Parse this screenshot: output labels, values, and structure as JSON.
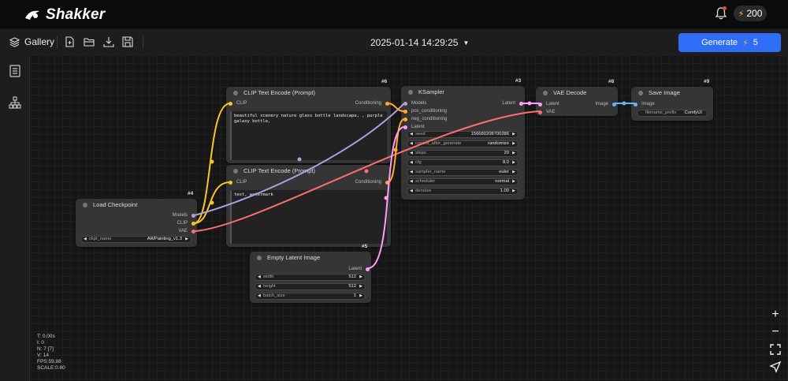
{
  "header": {
    "brand": "Shakker",
    "credits": "200"
  },
  "toolbar": {
    "gallery_label": "Gallery",
    "workflow_title": "2025-01-14 14:29:25",
    "generate_label": "Generate",
    "generate_cost": "5"
  },
  "nodes": {
    "clip_pos": {
      "id": "#6",
      "title": "CLIP Text Encode (Prompt)",
      "input_clip": "CLIP",
      "output": "Conditioning",
      "text": "beautiful scenery nature glass bottle landscape, , purple galaxy bottle,"
    },
    "clip_neg": {
      "id": "",
      "title": "CLIP Text Encode (Prompt)",
      "input_clip": "CLIP",
      "output": "Conditioning",
      "text": "text, watermark"
    },
    "ksampler": {
      "id": "#3",
      "title": "KSampler",
      "inputs": [
        "Models",
        "pos_conditioning",
        "neg_conditioning",
        "Latent"
      ],
      "output": "Latent",
      "widgets": [
        {
          "label": "seed",
          "value": "156680208700286"
        },
        {
          "label": "control_after_generate",
          "value": "randomize"
        },
        {
          "label": "steps",
          "value": "20"
        },
        {
          "label": "cfg",
          "value": "8.0"
        },
        {
          "label": "sampler_name",
          "value": "euler"
        },
        {
          "label": "scheduler",
          "value": "normal"
        },
        {
          "label": "denoise",
          "value": "1.00"
        }
      ]
    },
    "vae_decode": {
      "id": "#8",
      "title": "VAE Decode",
      "inputs": [
        "Latent",
        "VAE"
      ],
      "output": "Image"
    },
    "save_image": {
      "id": "#9",
      "title": "Save Image",
      "input": "Image",
      "widget_label": "filename_prefix",
      "widget_value": "ComfyUI"
    },
    "load_checkpoint": {
      "id": "#4",
      "title": "Load Checkpoint",
      "outputs": [
        "Models",
        "CLIP",
        "VAE"
      ],
      "widget_label": "ckpt_name",
      "widget_value": "AWPainting_v1.3"
    },
    "empty_latent": {
      "id": "#5",
      "title": "Empty Latent Image",
      "output": "Latent",
      "widgets": [
        {
          "label": "width",
          "value": "512"
        },
        {
          "label": "height",
          "value": "512"
        },
        {
          "label": "batch_size",
          "value": "1"
        }
      ]
    }
  },
  "stats": [
    "T: 0.00s",
    "I: 0",
    "N: 7 [7]",
    "V: 14",
    "FPS:59.88",
    "SCALE:0.80"
  ],
  "colors": {
    "accent": "#2f6df6",
    "wire_clip": "#f7c726",
    "wire_model": "#b39ddb",
    "wire_latent": "#ff9cf9",
    "wire_vae": "#ff6e6e",
    "wire_conditioning": "#ffa931",
    "wire_image": "#64b5f6"
  }
}
